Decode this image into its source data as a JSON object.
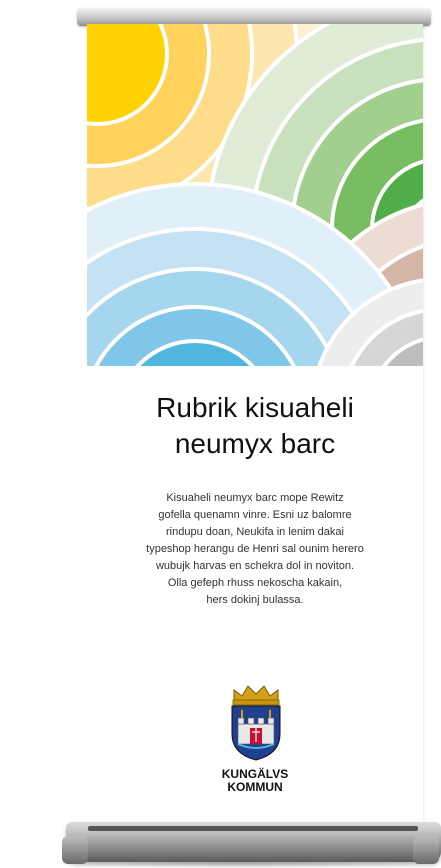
{
  "banner": {
    "headline_line1": "Rubrik kisuaheli",
    "headline_line2": "neumyx barc",
    "body_lines": [
      "Kisuaheli neumyx barc mope Rewitz",
      "gofella quenamn vinre. Esni uz balomre",
      "rindupu doan, Neukifa in lenim dakai",
      "typeshop herangu de Henri sal ounim herero",
      "wubujk harvas en schekra dol in noviton.",
      "Olla gefeph rhuss nekoscha kakain,",
      "hers dokinj bulassa."
    ],
    "logo_line1": "KUNGÄLVS",
    "logo_line2": "KOMMUN"
  },
  "colors": {
    "yellow": "#ffd200",
    "green": "#16a34a",
    "blue": "#4fb6e0",
    "brown": "#b08a78",
    "gray": "#9a9a9a",
    "crest_blue": "#1f3f8f",
    "crest_red": "#c8102e",
    "crest_gold": "#d4a017"
  },
  "icons": {
    "artwork": "concentric-arcs-artwork",
    "crest": "coat-of-arms-icon"
  }
}
